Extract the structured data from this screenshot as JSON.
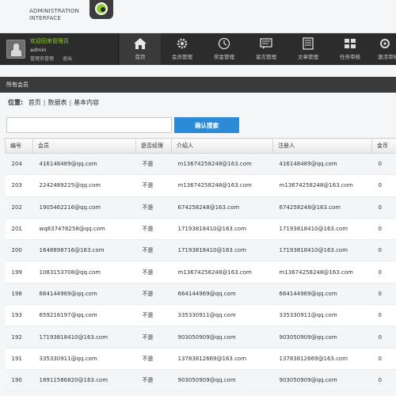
{
  "header": {
    "title_line1": "ADMINISTRATION",
    "title_line2": "INTERFACE"
  },
  "user": {
    "welcome": "欢迎回来管理员",
    "name": "admin",
    "links": [
      "管理员管理",
      "退出"
    ]
  },
  "nav": {
    "items": [
      {
        "label": "首页",
        "icon": "home-icon"
      },
      {
        "label": "会员管理",
        "icon": "gear-icon"
      },
      {
        "label": "奖金管理",
        "icon": "clock-icon"
      },
      {
        "label": "留言管理",
        "icon": "message-icon"
      },
      {
        "label": "文章管理",
        "icon": "document-icon"
      },
      {
        "label": "任务审核",
        "icon": "grid-icon"
      },
      {
        "label": "激活审核",
        "icon": "settings-icon"
      }
    ]
  },
  "section": {
    "title": "所有会员"
  },
  "breadcrumb": {
    "label": "位置:",
    "items": [
      "首页",
      "数据表",
      "基本内容"
    ]
  },
  "search": {
    "value": "",
    "placeholder": "",
    "button_label": "确认搜索"
  },
  "table": {
    "headers": [
      "编号",
      "会员",
      "是否经理",
      "介绍人",
      "注册人",
      "金币"
    ],
    "rows": [
      [
        "204",
        "416148489@qq.com",
        "不是",
        "m13674258248@163.com",
        "416148489@qq.com",
        "0"
      ],
      [
        "203",
        "2242489225@qq.com",
        "不是",
        "m13674258248@163.com",
        "m13674258248@163.com",
        "0"
      ],
      [
        "202",
        "1905462216@qq.com",
        "不是",
        "674258248@163.com",
        "674258248@163.com",
        "0"
      ],
      [
        "201",
        "wq837478258@qq.com",
        "不是",
        "17193818410@163.com",
        "17193818410@163.com",
        "0"
      ],
      [
        "200",
        "1648898716@163.com",
        "不是",
        "17193818410@163.com",
        "17193818410@163.com",
        "0"
      ],
      [
        "199",
        "1083153708@qq.com",
        "不是",
        "m13674258248@163.com",
        "m13674258248@163.com",
        "0"
      ],
      [
        "198",
        "664144969@qq.com",
        "不是",
        "664144969@qq.com",
        "664144969@qq.com",
        "0"
      ],
      [
        "193",
        "659216197@qq.com",
        "不是",
        "335330911@qq.com",
        "335330911@qq.com",
        "0"
      ],
      [
        "192",
        "17193818410@163.com",
        "不是",
        "903050909@qq.com",
        "903050909@qq.com",
        "0"
      ],
      [
        "191",
        "335330911@qq.com",
        "不是",
        "13783812669@163.com",
        "13783812669@163.com",
        "0"
      ],
      [
        "190",
        "18911586820@163.com",
        "不是",
        "903050909@qq.com",
        "903050909@qq.com",
        "0"
      ]
    ]
  }
}
